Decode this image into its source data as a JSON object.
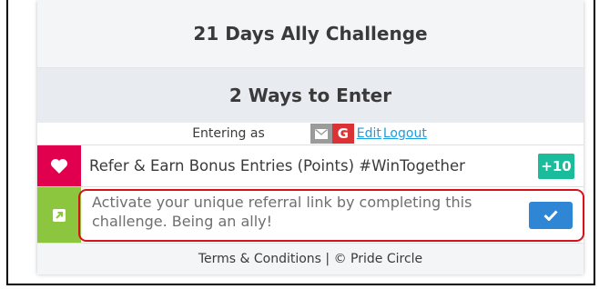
{
  "widget": {
    "title": "21 Days Ally Challenge",
    "ways_to_enter": "2 Ways to Enter",
    "entering_as_label": "Entering as",
    "edit_link": "Edit",
    "logout_link": "Logout",
    "google_letter": "G"
  },
  "entries": [
    {
      "icon": "heart-icon",
      "text": "Refer & Earn Bonus Entries (Points) #WinTogether",
      "points_badge": "+10",
      "color": "#e0004d"
    },
    {
      "icon": "external-link-icon",
      "text": "Activate your unique referral link by completing this challenge. Being an ally!",
      "color": "#8cc63f"
    }
  ],
  "footer": {
    "text": "Terms & Conditions | © Pride Circle"
  },
  "colors": {
    "points_badge": "#1abc9c",
    "check_button": "#2f86d4",
    "highlight_border": "#d8101a"
  }
}
